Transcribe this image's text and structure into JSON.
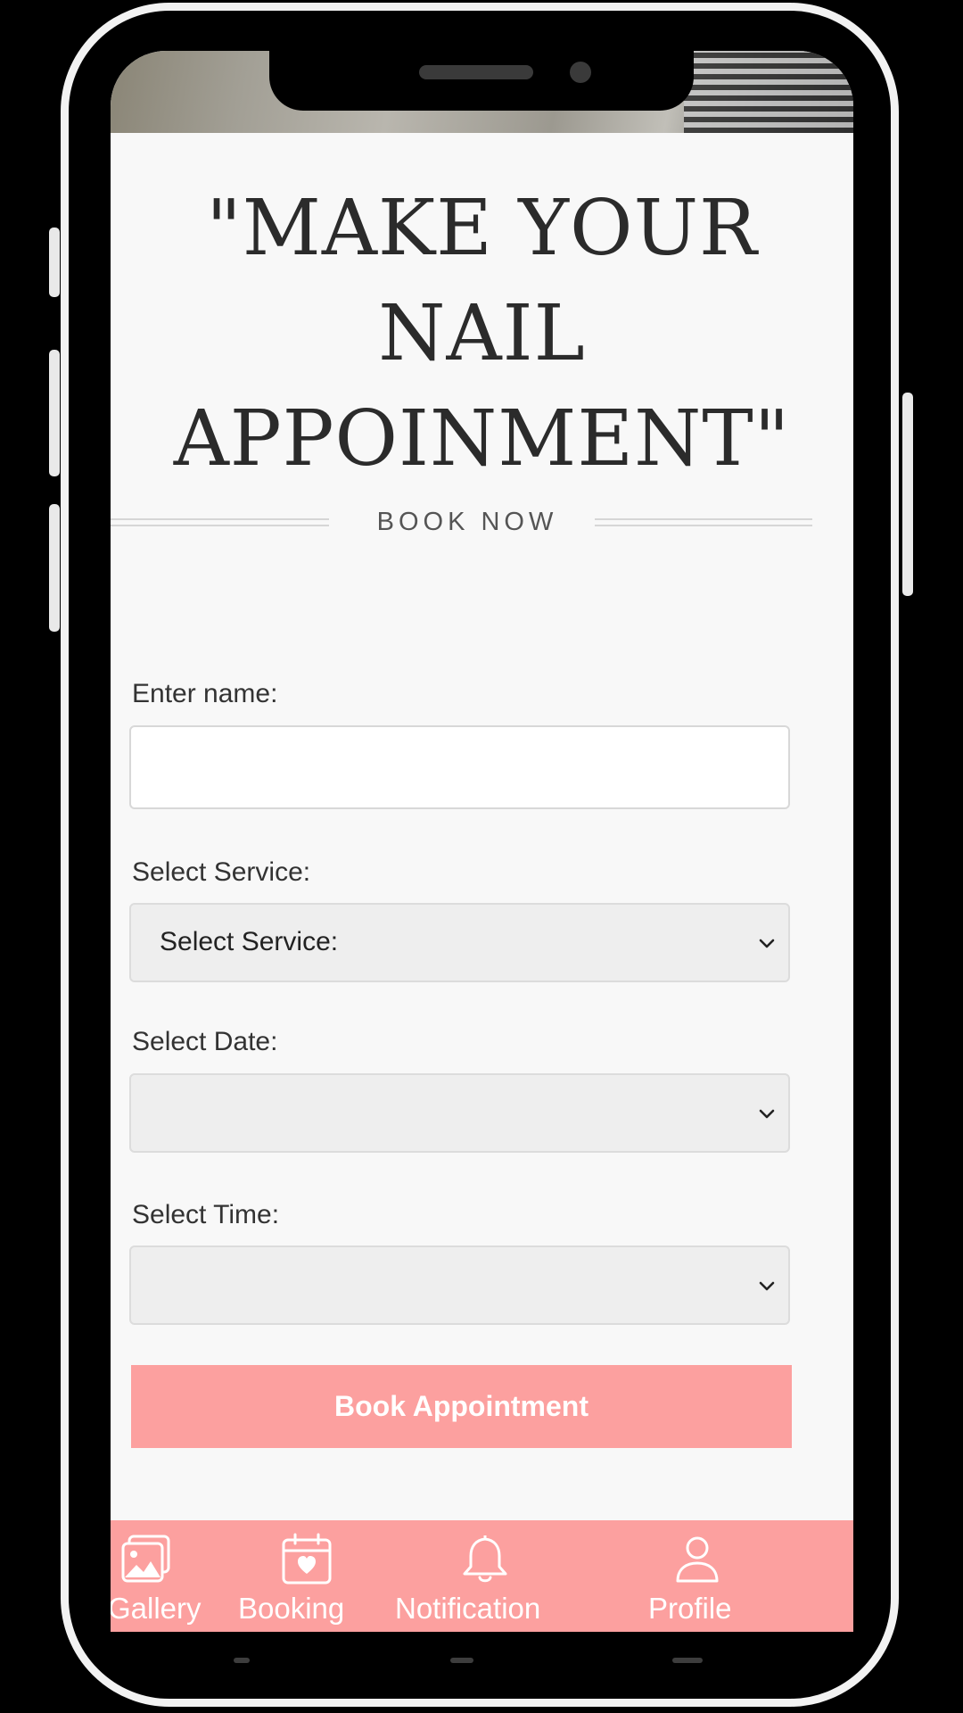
{
  "headline": {
    "line1": "\"MAKE YOUR",
    "line2": "NAIL",
    "line3": "APPOINMENT\""
  },
  "book_now": "BOOK NOW",
  "form": {
    "name_label": "Enter name:",
    "name_value": "",
    "service_label": "Select Service:",
    "service_selected": "Select Service:",
    "date_label": "Select Date:",
    "date_selected": "",
    "time_label": "Select Time:",
    "time_selected": "",
    "submit_label": "Book Appointment"
  },
  "nav": {
    "items": [
      {
        "label": "Gallery",
        "icon": "gallery-icon"
      },
      {
        "label": "Booking",
        "icon": "calendar-heart-icon"
      },
      {
        "label": "Notification",
        "icon": "bell-icon"
      },
      {
        "label": "Profile",
        "icon": "user-icon"
      }
    ]
  },
  "colors": {
    "accent": "#fca09f",
    "background": "#f8f8f8",
    "text": "#2b2b2b",
    "select_bg": "#eeeeee"
  }
}
